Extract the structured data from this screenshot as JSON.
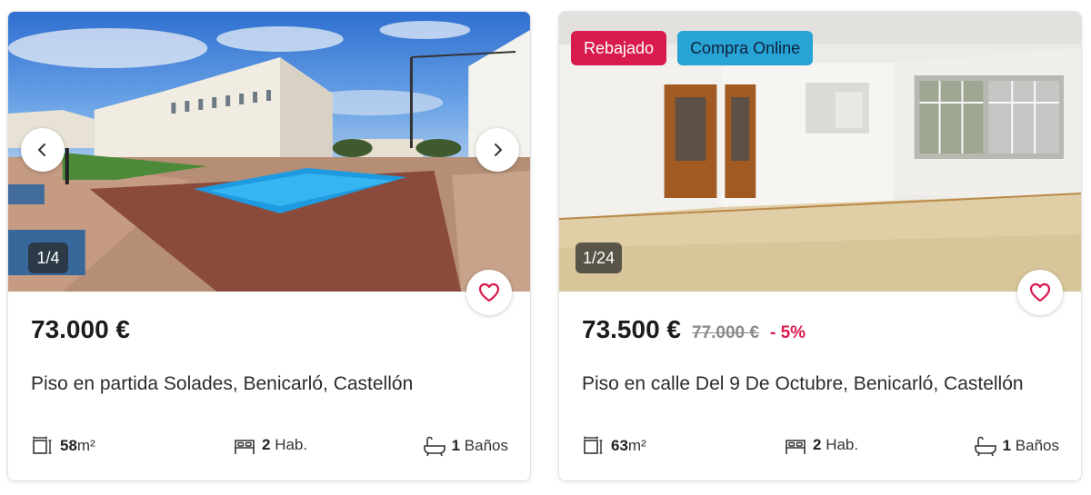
{
  "listings": [
    {
      "photo_counter": "1/4",
      "price": "73.000 €",
      "title": "Piso en partida Solades, Benicarló, Castellón",
      "area_value": "58",
      "area_unit": "m²",
      "rooms_value": "2",
      "rooms_label": "Hab.",
      "baths_value": "1",
      "baths_label": "Baños"
    },
    {
      "photo_counter": "1/24",
      "badges": [
        "Rebajado",
        "Compra Online"
      ],
      "price": "73.500 €",
      "old_price": "77.000 €",
      "discount": "- 5%",
      "title": "Piso en calle Del 9 De Octubre, Benicarló, Castellón",
      "area_value": "63",
      "area_unit": "m²",
      "rooms_value": "2",
      "rooms_label": "Hab.",
      "baths_value": "1",
      "baths_label": "Baños"
    }
  ],
  "icons": {
    "prev": "chevron-left-icon",
    "next": "chevron-right-icon",
    "favorite": "heart-icon",
    "area": "area-icon",
    "rooms": "bed-icon",
    "baths": "bathtub-icon"
  },
  "colors": {
    "accent": "#d81b4c",
    "badge_red": "#d81b4c",
    "badge_blue": "#27a3d6"
  }
}
